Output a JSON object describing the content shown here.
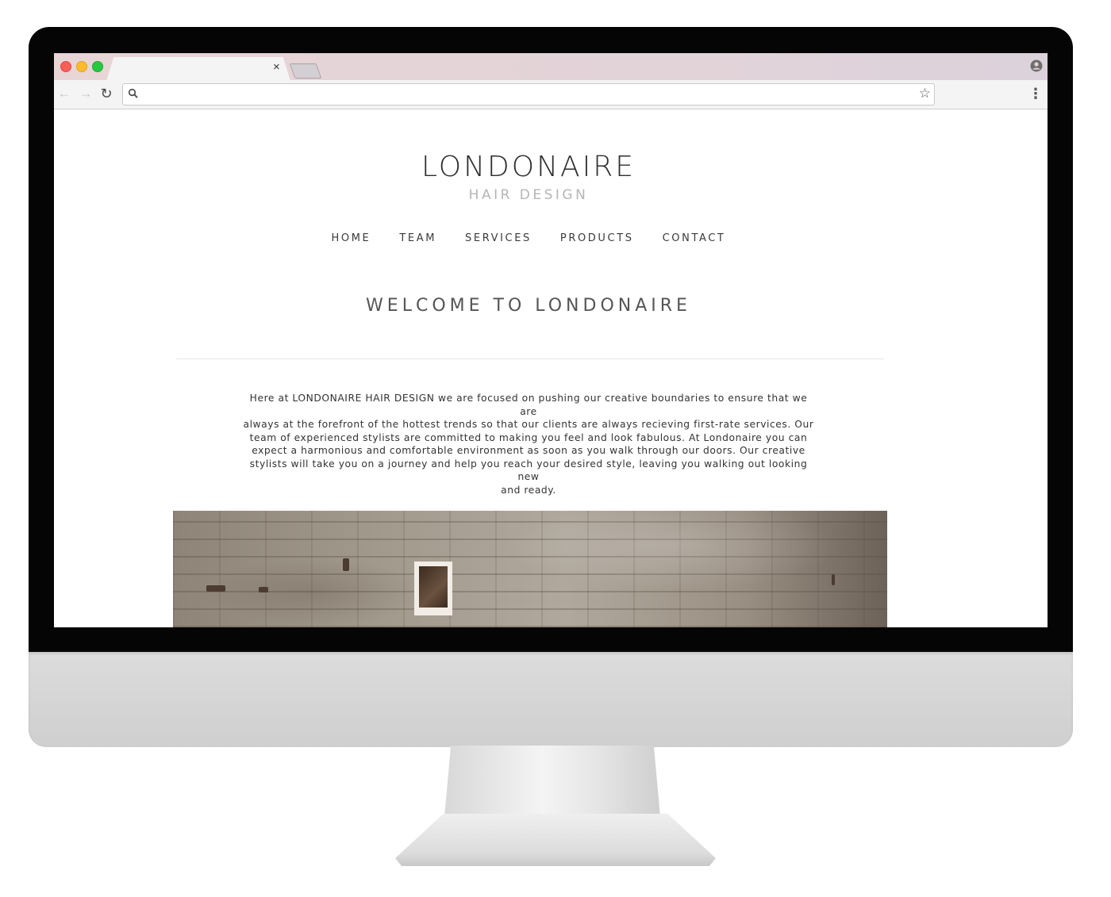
{
  "browser": {
    "tab_close_symbol": "×",
    "address_value": ""
  },
  "site": {
    "brand_name": "LONDONAIRE",
    "brand_tagline": "HAIR DESIGN",
    "nav": [
      "HOME",
      "TEAM",
      "SERVICES",
      "PRODUCTS",
      "CONTACT"
    ],
    "heading": "WELCOME TO LONDONAIRE",
    "intro_lines": [
      "Here at LONDONAIRE HAIR DESIGN we are focused on pushing our creative boundaries to ensure that we are",
      "always at the forefront of the hottest trends so that our clients are always recieving first-rate services. Our",
      "team of experienced stylists are committed to making you feel and look fabulous. At Londonaire you can",
      "expect a harmonious and comfortable environment as soon as you walk through our doors. Our creative",
      "stylists will take you on a journey and help you reach your desired style, leaving you walking out looking new",
      "and ready."
    ]
  },
  "colors": {
    "tabbar": "#e6d4d6",
    "heading_text": "#555555",
    "tagline_text": "#b5b5b5"
  },
  "icons": {
    "back": "arrow-left-icon",
    "forward": "arrow-right-icon",
    "reload": "reload-icon",
    "search": "search-icon",
    "bookmark": "star-icon",
    "menu": "kebab-menu-icon",
    "profile": "profile-icon"
  }
}
